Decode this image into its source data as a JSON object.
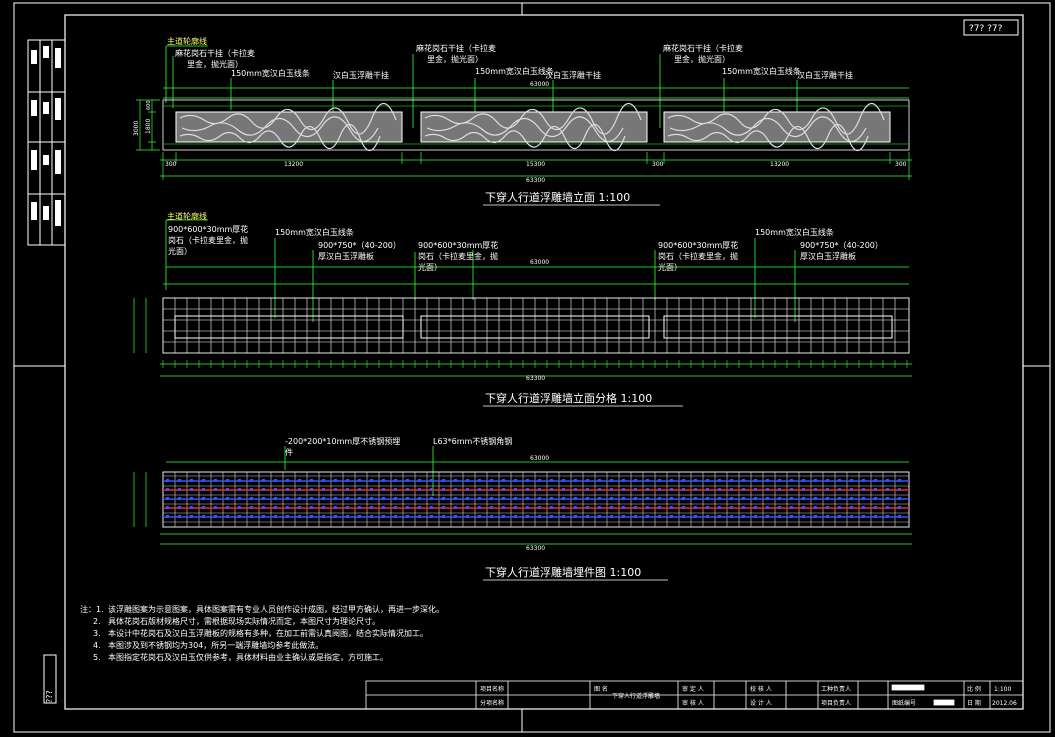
{
  "sheet": {
    "page_no": "?7? ?7?",
    "side_stamp": "???"
  },
  "elevation": {
    "labels": {
      "main_contour": "主道轮廓线",
      "granite_a": "麻花岗石干挂（卡拉麦",
      "granite_b": "里金，抛光面）",
      "band": "150mm宽汉白玉线条",
      "relief": "汉白玉浮雕干挂"
    },
    "dims_top": "63000",
    "dims_bottom": [
      "300",
      "13200",
      "15300",
      "300",
      "13200",
      "300"
    ],
    "total": "63300",
    "side_dims": [
      "3000",
      "1800",
      "600"
    ],
    "title": "下穿人行道浮雕墙立面    1:100"
  },
  "division": {
    "labels": {
      "main_contour": "主道轮廓线",
      "tile_a": "900*600*30mm厚花",
      "tile_b": "岗石（卡拉麦里金，抛",
      "tile_c": "光面）",
      "band": "150mm宽汉白玉线条",
      "panel_a": "900*750*（40-200）",
      "panel_b": "厚汉白玉浮雕板",
      "mid_tile_a": "900*600*30mm厚花",
      "mid_tile_b": "岗石（卡拉麦里金，抛",
      "mid_tile_c": "光面）",
      "right_tile_a": "900*600*30mm厚花",
      "right_tile_b": "岗石（卡拉麦里金，抛",
      "right_tile_c": "光面）",
      "right_panel_a": "900*750*（40-200）",
      "right_panel_b": "厚汉白玉浮雕板"
    },
    "dims_top": "63000",
    "total": "63300",
    "title": "下穿人行道浮雕墙立面分格    1:100"
  },
  "embed": {
    "labels": {
      "plate": "-200*200*10mm厚不锈钢预埋",
      "plate_b": "件",
      "angle": "L63*6mm不锈钢角钢"
    },
    "dims_top": "63000",
    "total": "63300",
    "title": "下穿人行道浮雕墙埋件图    1:100"
  },
  "notes": {
    "head": "注：1.",
    "lines": [
      "该浮雕图案为示意图案，具体图案需有专业人员创作设计成图，经过甲方确认，再进一步深化。",
      "具体花岗石版材规格尺寸，需根据现场实际情况而定，本图尺寸为理论尺寸。",
      "本设计中花岗石及汉白玉浮雕板的规格有多种，在加工前需认真阅图，结合实际情况加工。",
      "本图涉及到不锈钢均为304，所另一端浮雕墙均参考此做法。",
      "本图指定花岗石及汉白玉仅供参考，具体材料由业主确认或是指定，方可施工。"
    ],
    "nums": [
      "2.",
      "3.",
      "4.",
      "5."
    ]
  },
  "title_block": {
    "project_name_label": "项目名称",
    "sub_project_label": "分项名称",
    "drawing_name_label": "图    名",
    "drawing_name": "下穿人行道浮雕墙",
    "approve": "审 定 人",
    "review": "审 核 人",
    "check": "校 核 人",
    "design": "设 计 人",
    "discipline_lead": "工种负责人",
    "project_lead": "项目负责人",
    "drawing_no_label": "图纸编号",
    "scale_label": "比  例",
    "scale": "1:100",
    "date_label": "日  期",
    "date": "2012.06"
  },
  "colors": {
    "line": "#ffffff",
    "green": "#33ff33",
    "yellow": "#ffff66",
    "red": "#ff2222",
    "blue": "#3355ff",
    "cyan": "#33ffff"
  }
}
